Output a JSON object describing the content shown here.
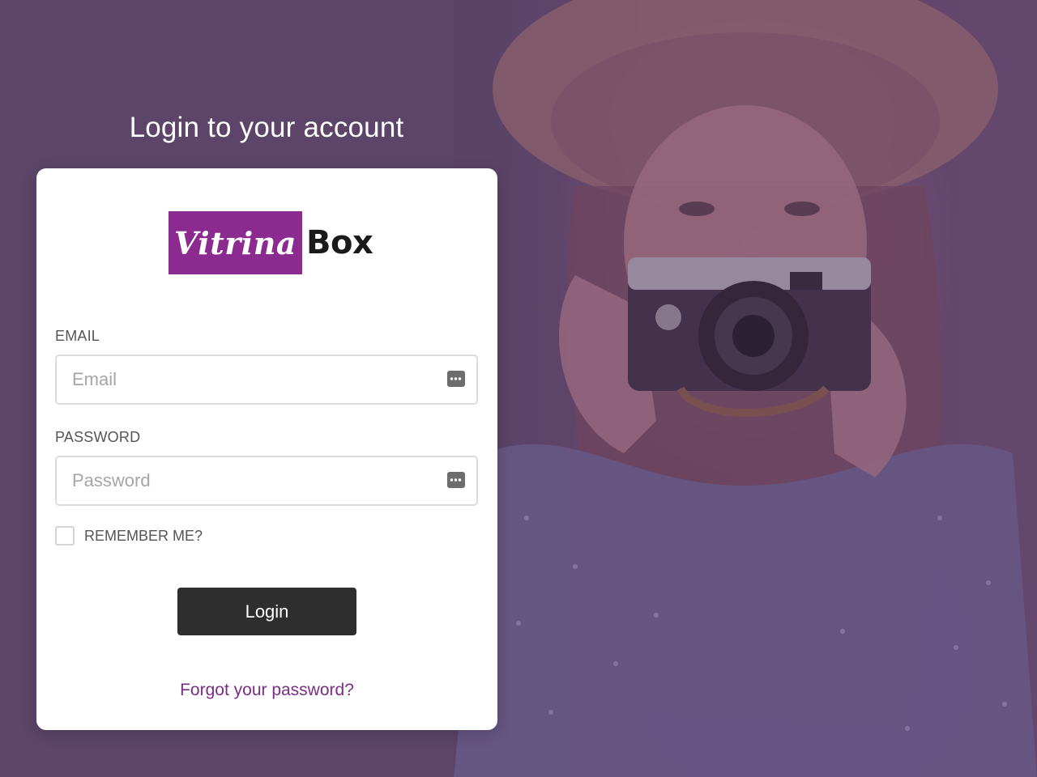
{
  "page": {
    "title": "Login to your account"
  },
  "brand": {
    "logo_script": "Vitrina",
    "logo_word": "Box",
    "accent_color": "#8b2a8f"
  },
  "form": {
    "email": {
      "label": "EMAIL",
      "placeholder": "Email",
      "value": "",
      "icon": "password-manager-icon"
    },
    "password": {
      "label": "PASSWORD",
      "placeholder": "Password",
      "value": "",
      "icon": "password-manager-icon"
    },
    "remember": {
      "label": "REMEMBER ME?",
      "checked": false
    },
    "submit_label": "Login",
    "forgot_label": "Forgot your password?"
  },
  "colors": {
    "background_overlay": "#5c4569",
    "button": "#2e2e2e",
    "link": "#7b2d86"
  }
}
